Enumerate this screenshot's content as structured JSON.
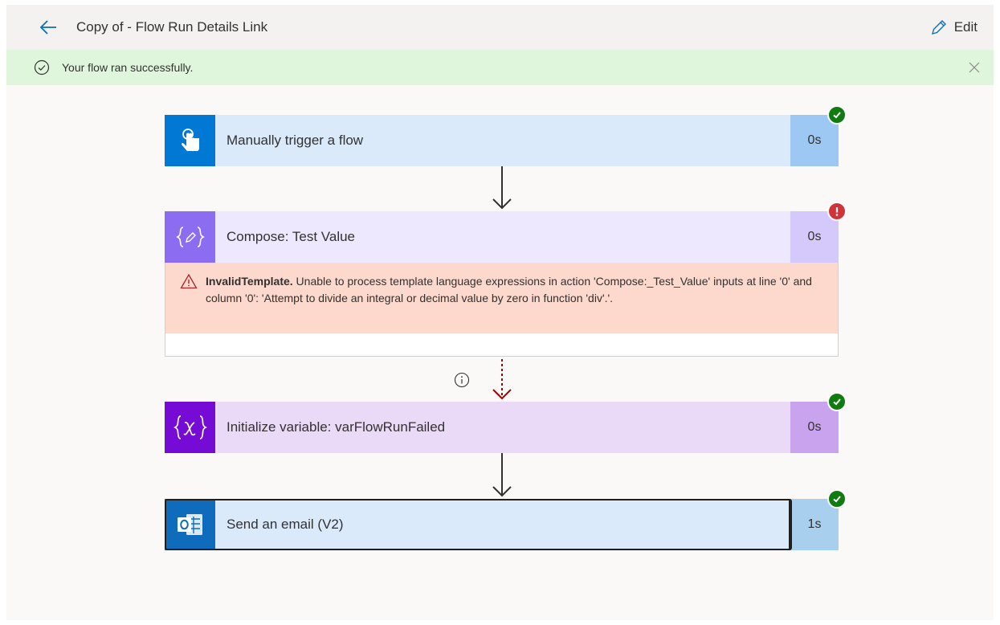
{
  "header": {
    "title": "Copy of - Flow Run Details Link",
    "edit_label": "Edit"
  },
  "banner": {
    "message": "Your flow ran successfully."
  },
  "steps": [
    {
      "label": "Manually trigger a flow",
      "duration": "0s",
      "status": "success",
      "icon": "touch-icon"
    },
    {
      "label": "Compose: Test Value",
      "duration": "0s",
      "status": "failed",
      "icon": "compose-icon"
    },
    {
      "label": "Initialize variable: varFlowRunFailed",
      "duration": "0s",
      "status": "success",
      "icon": "variable-icon"
    },
    {
      "label": "Send an email (V2)",
      "duration": "1s",
      "status": "success",
      "icon": "outlook-icon"
    }
  ],
  "error": {
    "title": "InvalidTemplate.",
    "message": " Unable to process template language expressions in action 'Compose:_Test_Value' inputs at line '0' and column '0': 'Attempt to divide an integral or decimal value by zero in function 'div'.'."
  },
  "colors": {
    "success": "#107c10",
    "failed": "#d13438",
    "banner_bg": "#dff6dd",
    "error_bg": "#fdd8cc"
  }
}
